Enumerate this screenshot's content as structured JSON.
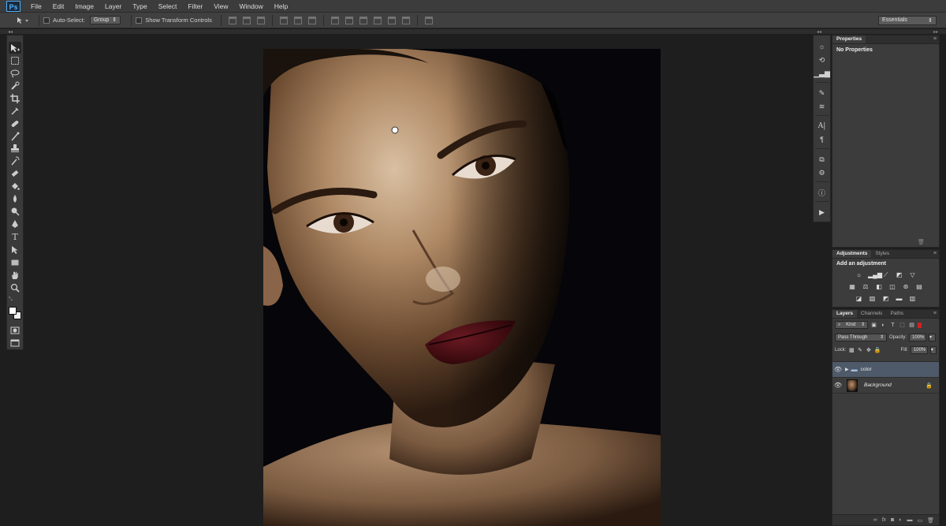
{
  "app": {
    "logo": "Ps"
  },
  "menu": [
    "File",
    "Edit",
    "Image",
    "Layer",
    "Type",
    "Select",
    "Filter",
    "View",
    "Window",
    "Help"
  ],
  "options": {
    "auto_select_label": "Auto-Select:",
    "auto_select_value": "Group",
    "transform_label": "Show Transform Controls",
    "workspace": "Essentials"
  },
  "tools": [
    "move-tool",
    "marquee-tool",
    "lasso-tool",
    "quick-select-tool",
    "crop-tool",
    "eyedropper-tool",
    "healing-brush-tool",
    "brush-tool",
    "clone-stamp-tool",
    "history-brush-tool",
    "eraser-tool",
    "paint-bucket-tool",
    "blur-tool",
    "dodge-tool",
    "pen-tool",
    "type-tool",
    "path-select-tool",
    "rectangle-tool",
    "hand-tool",
    "zoom-tool"
  ],
  "properties": {
    "tab": "Properties",
    "heading": "No Properties"
  },
  "adjustments": {
    "tabs": [
      "Adjustments",
      "Styles"
    ],
    "heading": "Add an adjustment"
  },
  "layers": {
    "tabs": [
      "Layers",
      "Channels",
      "Paths"
    ],
    "filter": "Kind",
    "blend_mode": "Pass Through",
    "opacity_label": "Opacity:",
    "opacity_value": "100%",
    "lock_label": "Lock:",
    "fill_label": "Fill:",
    "fill_value": "100%",
    "items": [
      {
        "name": "color",
        "type": "group",
        "selected": true
      },
      {
        "name": "Background",
        "type": "image",
        "locked": true
      }
    ]
  }
}
